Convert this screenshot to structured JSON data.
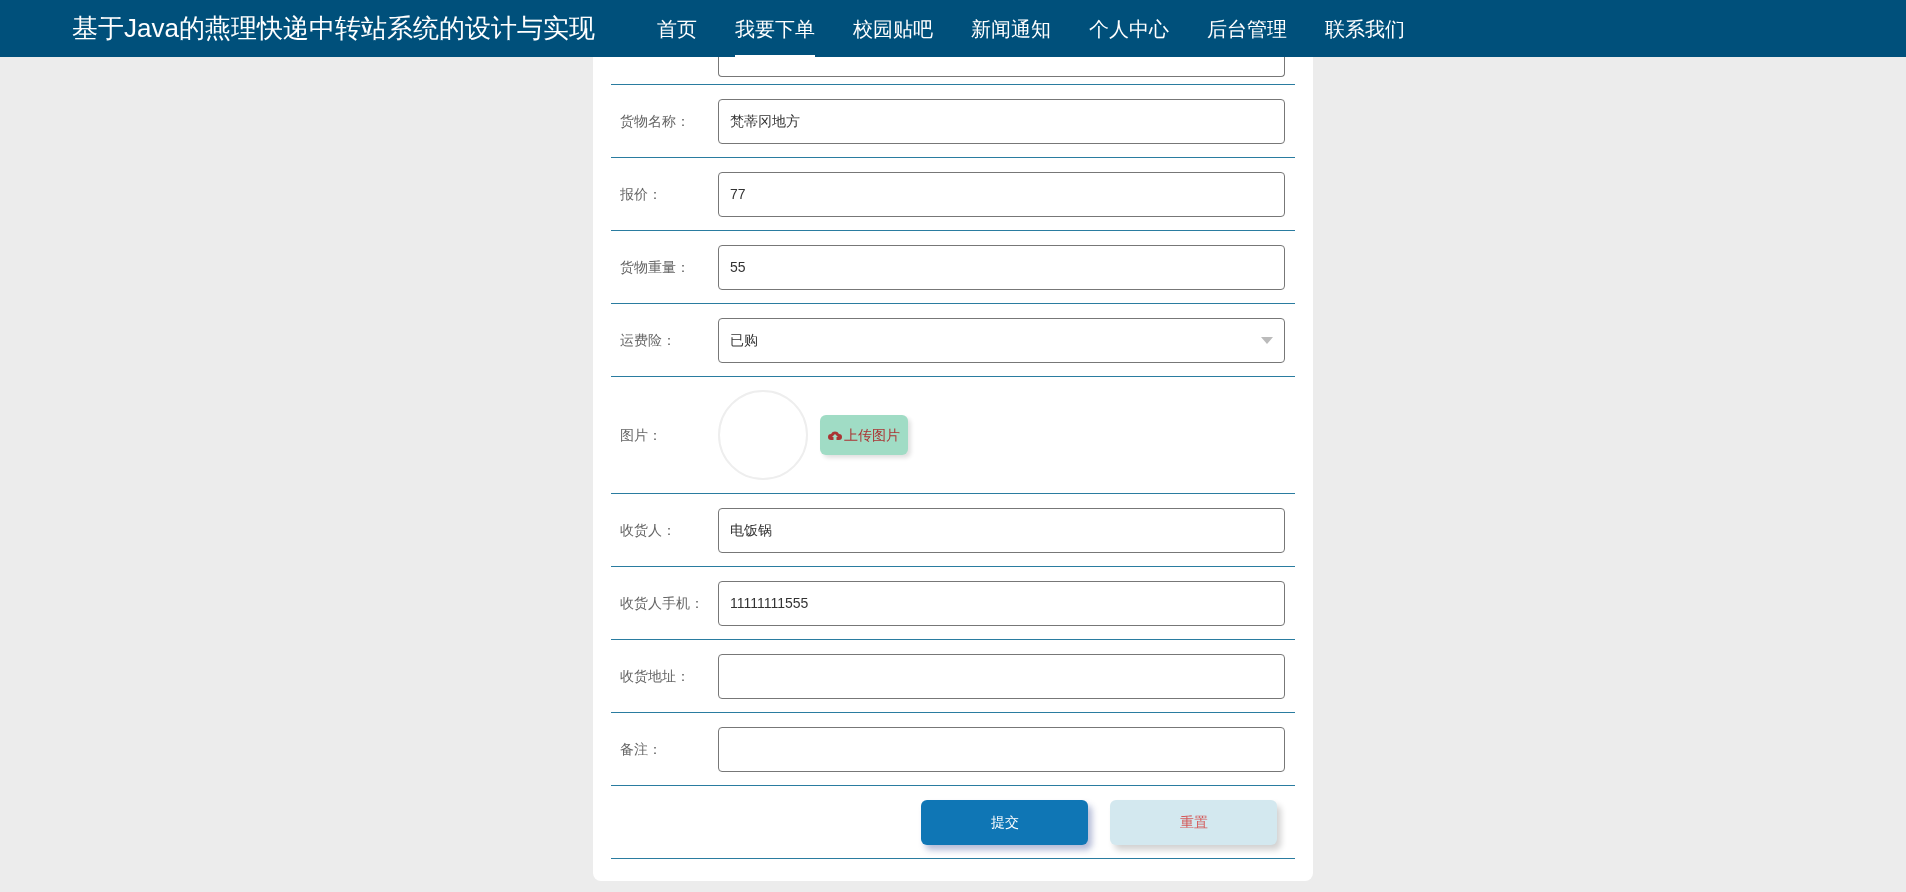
{
  "header": {
    "title": "基于Java的燕理快递中转站系统的设计与实现"
  },
  "nav": [
    {
      "label": "首页",
      "selected": false
    },
    {
      "label": "我要下单",
      "selected": true
    },
    {
      "label": "校园贴吧",
      "selected": false
    },
    {
      "label": "新闻通知",
      "selected": false
    },
    {
      "label": "个人中心",
      "selected": false
    },
    {
      "label": "后台管理",
      "selected": false
    },
    {
      "label": "联系我们",
      "selected": false
    }
  ],
  "form": {
    "rows": [
      {
        "kind": "text",
        "label": "货物名称：",
        "value": "梵蒂冈地方"
      },
      {
        "kind": "text",
        "label": "报价：",
        "value": "77"
      },
      {
        "kind": "text",
        "label": "货物重量：",
        "value": "55"
      },
      {
        "kind": "select",
        "label": "运费险：",
        "value": "已购"
      },
      {
        "kind": "image",
        "label": "图片：",
        "button": "上传图片"
      },
      {
        "kind": "text",
        "label": "收货人：",
        "value": "电饭锅"
      },
      {
        "kind": "text",
        "label": "收货人手机：",
        "value": "11111111555"
      },
      {
        "kind": "text",
        "label": "收货地址："
      },
      {
        "kind": "text",
        "label": "备注："
      }
    ],
    "buttons": [
      {
        "kind": "primary",
        "label": "提交"
      },
      {
        "kind": "secondary",
        "label": "重置"
      }
    ]
  }
}
